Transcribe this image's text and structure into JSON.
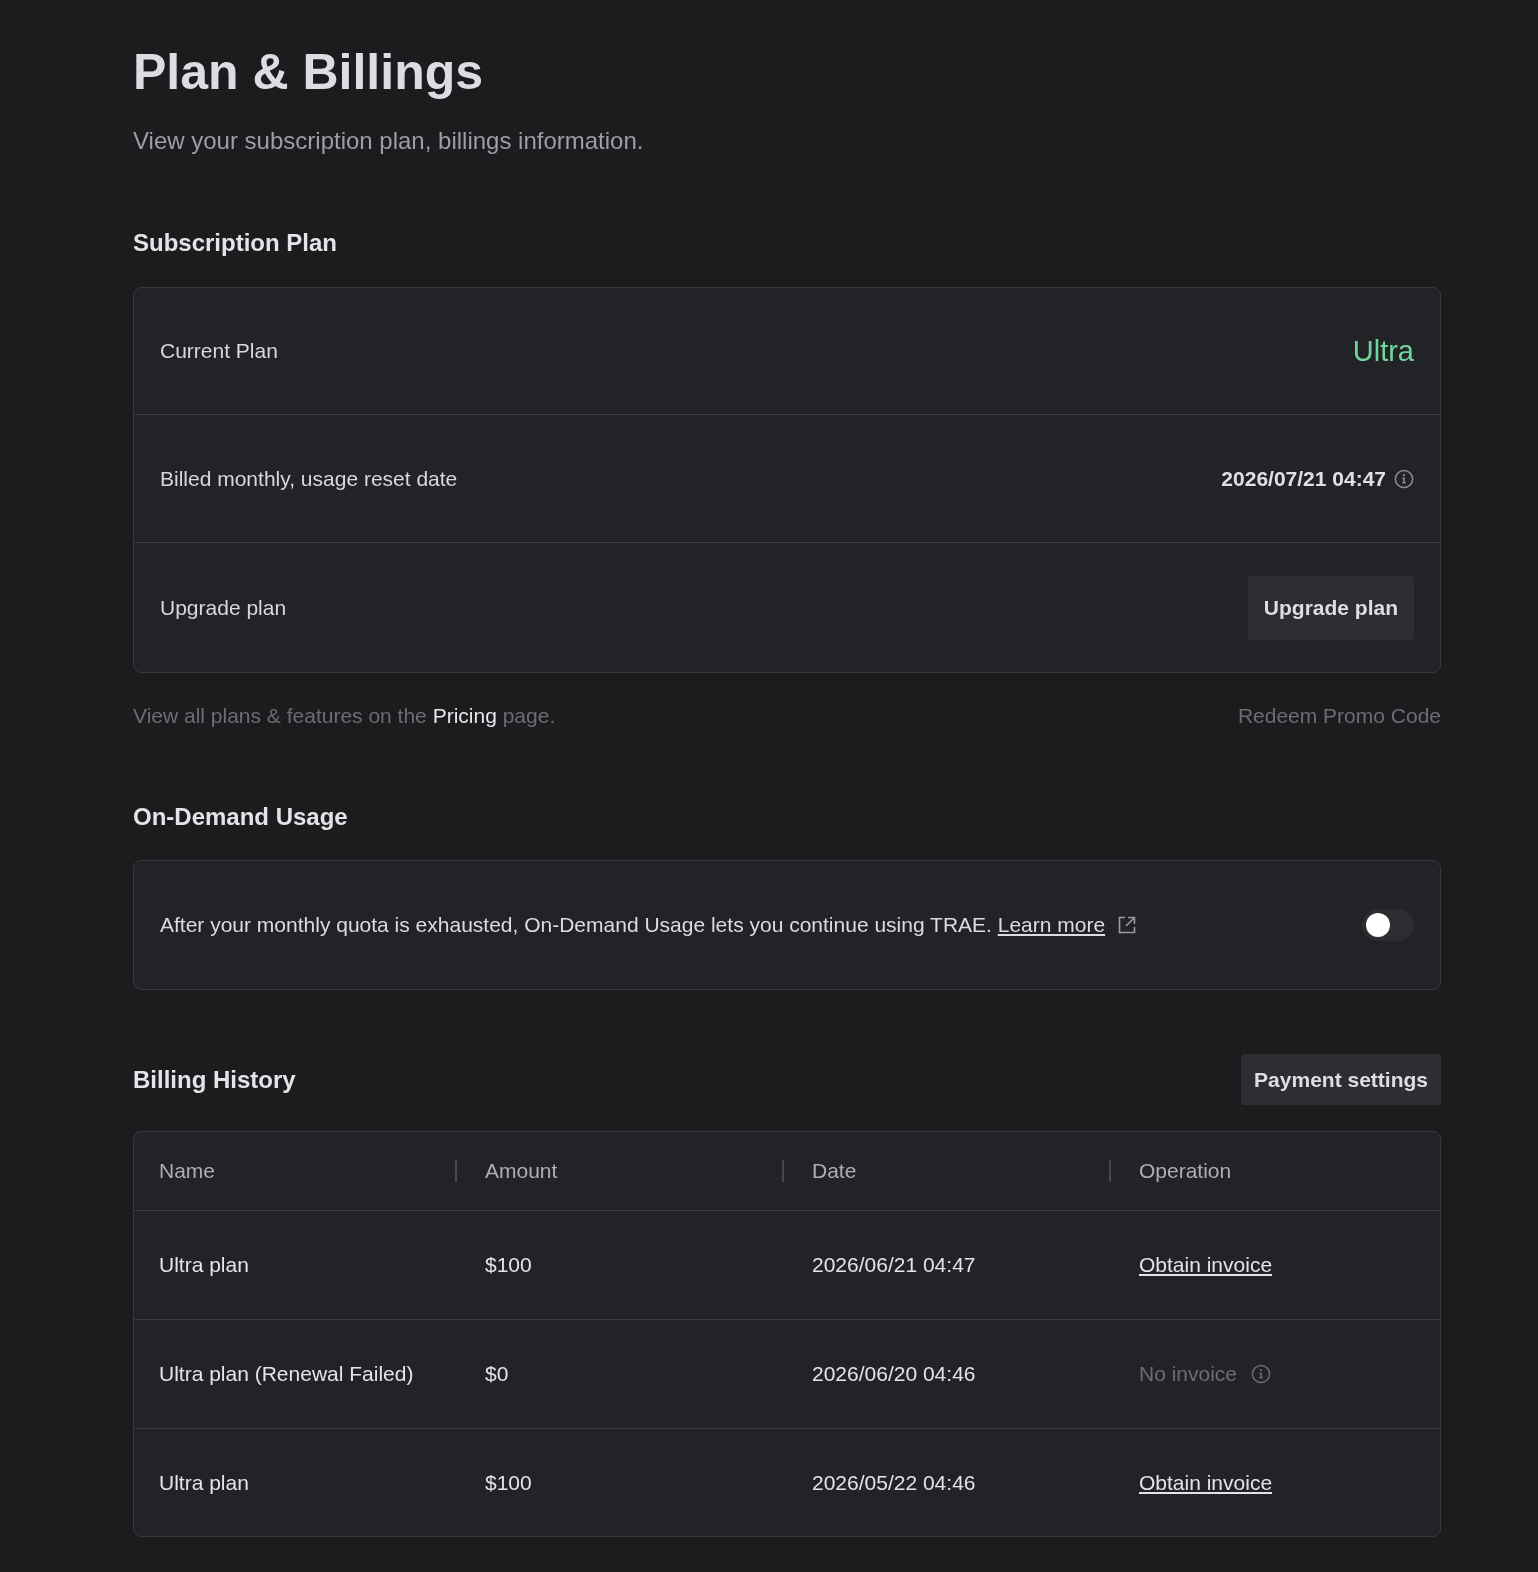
{
  "page": {
    "title": "Plan & Billings",
    "subtitle": "View your subscription plan, billings information."
  },
  "subscription_plan": {
    "heading": "Subscription Plan",
    "rows": [
      {
        "kind": "plan",
        "label": "Current Plan",
        "value": "Ultra"
      },
      {
        "kind": "date",
        "label": "Billed monthly, usage reset date",
        "value": "2026/07/21 04:47"
      },
      {
        "kind": "action",
        "label": "Upgrade plan",
        "button": "Upgrade plan"
      }
    ],
    "note": {
      "before": "View all plans & features on the",
      "link": "Pricing",
      "after": "page."
    },
    "redeem_link": "Redeem Promo Code"
  },
  "on_demand_usage": {
    "heading": "On-Demand Usage",
    "text": "After your monthly quota is exhausted, On-Demand Usage lets you continue using TRAE.",
    "link": "Learn more",
    "on": false
  },
  "billing_history": {
    "heading": "Billing History",
    "button": "Payment settings",
    "table": {
      "columns": [
        "Name",
        "Amount",
        "Date",
        "Operation"
      ],
      "rows": [
        {
          "cells": [
            "Ultra plan",
            "$100",
            "2026/06/21 04:47"
          ],
          "operation": {
            "kind": "link",
            "text": "Obtain invoice"
          }
        },
        {
          "cells": [
            "Ultra plan (Renewal Failed)",
            "$0",
            "2026/06/20 04:46"
          ],
          "operation": {
            "kind": "unavailable",
            "text": "No invoice"
          }
        },
        {
          "cells": [
            "Ultra plan",
            "$100",
            "2026/05/22 04:46"
          ],
          "operation": {
            "kind": "link",
            "text": "Obtain invoice"
          }
        }
      ]
    }
  }
}
